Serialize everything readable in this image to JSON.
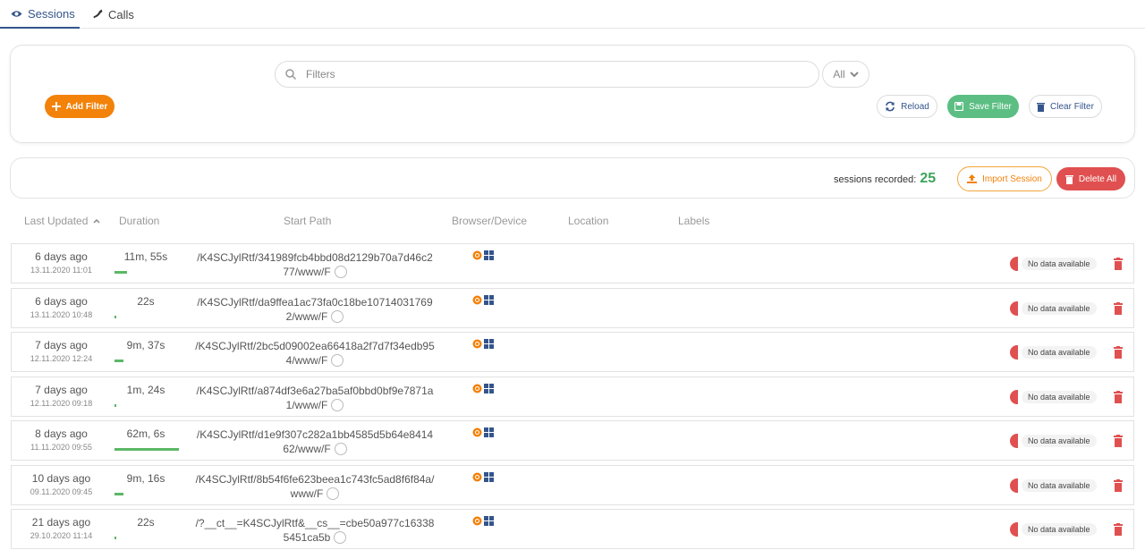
{
  "tabs": [
    {
      "label": "Sessions",
      "icon": "eye-icon",
      "active": true
    },
    {
      "label": "Calls",
      "icon": "phone-icon",
      "active": false
    }
  ],
  "filter": {
    "search_placeholder": "Filters",
    "scope": "All",
    "add_filter": "Add Filter",
    "reload": "Reload",
    "save_filter": "Save Filter",
    "clear_filter": "Clear Filter"
  },
  "sessions_bar": {
    "recorded_label": "sessions recorded:",
    "recorded_count": "25",
    "import_session": "Import Session",
    "delete_all": "Delete All"
  },
  "table": {
    "headers": {
      "last_updated": "Last Updated",
      "duration": "Duration",
      "start_path": "Start Path",
      "browser_device": "Browser/Device",
      "location": "Location",
      "labels": "Labels"
    },
    "rows": [
      {
        "ago": "6 days ago",
        "date": "13.11.2020 11:01",
        "duration": "11m, 55s",
        "duration_fraction": 0.19,
        "path": "/K4SCJylRtf/341989fcb4bbd08d2129b70a7d46c277/www/F",
        "label": "No data available"
      },
      {
        "ago": "6 days ago",
        "date": "13.11.2020 10:48",
        "duration": "22s",
        "duration_fraction": 0.01,
        "path": "/K4SCJylRtf/da9ffea1ac73fa0c18be107140317692/www/F",
        "label": "No data available"
      },
      {
        "ago": "7 days ago",
        "date": "12.11.2020 12:24",
        "duration": "9m, 37s",
        "duration_fraction": 0.14,
        "path": "/K4SCJylRtf/2bc5d09002ea66418a2f7d7f34edb954/www/F",
        "label": "No data available"
      },
      {
        "ago": "7 days ago",
        "date": "12.11.2020 09:18",
        "duration": "1m, 24s",
        "duration_fraction": 0.02,
        "path": "/K4SCJylRtf/a874df3e6a27ba5af0bbd0bf9e7871a1/www/F",
        "label": "No data available"
      },
      {
        "ago": "8 days ago",
        "date": "11.11.2020 09:55",
        "duration": "62m, 6s",
        "duration_fraction": 1.0,
        "path": "/K4SCJylRtf/d1e9f307c282a1bb4585d5b64e841462/www/F",
        "label": "No data available"
      },
      {
        "ago": "10 days ago",
        "date": "09.11.2020 09:45",
        "duration": "9m, 16s",
        "duration_fraction": 0.14,
        "path": "/K4SCJylRtf/8b54f6fe623beea1c743fc5ad8f6f84a/www/F",
        "label": "No data available"
      },
      {
        "ago": "21 days ago",
        "date": "29.10.2020 11:14",
        "duration": "22s",
        "duration_fraction": 0.01,
        "path": "/?__ct__=K4SCJylRtf&__cs__=cbe50a977c163385451ca5b",
        "label": "No data available"
      }
    ]
  },
  "icons": {
    "browser": "chrome-icon",
    "device": "windows-icon",
    "label_status": "half-circle-icon",
    "row_delete": "trash-icon"
  },
  "colors": {
    "accent": "#34558b",
    "orange": "#f2820a",
    "green": "#5cbe83",
    "red": "#e05050"
  }
}
